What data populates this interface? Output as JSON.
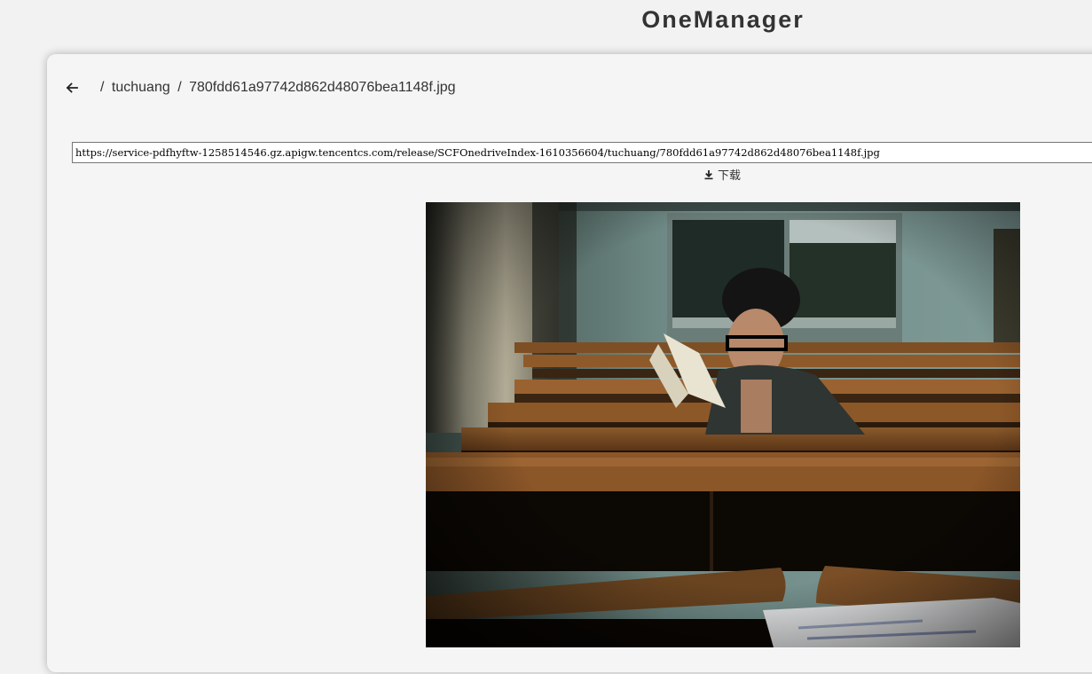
{
  "app": {
    "title": "OneManager"
  },
  "breadcrumb": {
    "items": [
      {
        "sep": "/",
        "label": "tuchuang"
      },
      {
        "sep": "/",
        "label": "780fdd61a97742d862d48076bea1148f.jpg"
      }
    ]
  },
  "file": {
    "url": "https://service-pdfhyftw-1258514546.gz.apigw.tencentcs.com/release/SCFOnedriveIndex-1610356604/tuchuang/780fdd61a97742d862d48076bea1148f.jpg",
    "download_label": "下载"
  },
  "icons": {
    "back": "arrow-left-icon",
    "download": "download-icon"
  },
  "colors": {
    "page_bg": "#f2f2f2",
    "card_bg": "#f5f5f5",
    "text": "#333333"
  }
}
